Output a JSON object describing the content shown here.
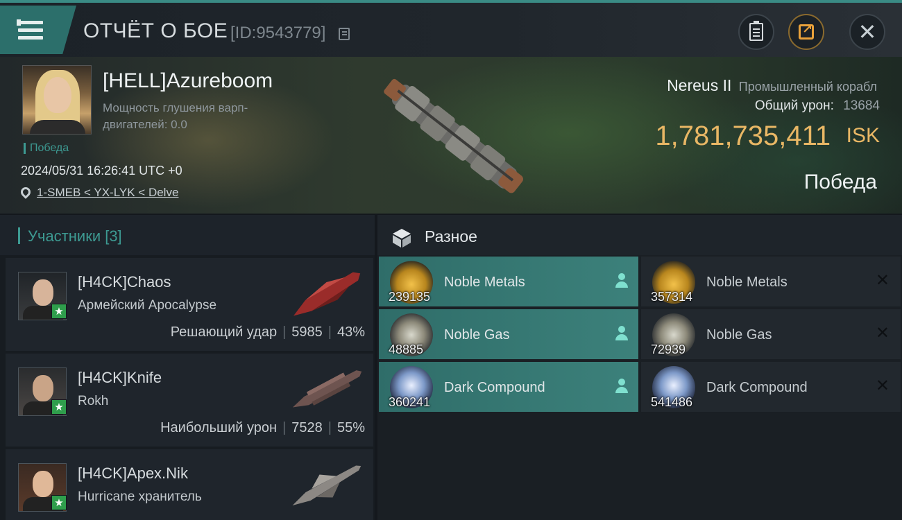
{
  "header": {
    "title": "ОТЧЁТ О БОЕ",
    "report_id": "[ID:9543779]"
  },
  "victim": {
    "name": "[HELL]Azureboom",
    "warp_label": "Мощность глушения варп-двигателей: 0.0",
    "status_tag": "Победа",
    "datetime": "2024/05/31 16:26:41 UTC +0",
    "location": "1-SMEB < YX-LYK < Delve",
    "ship_name": "Nereus II",
    "ship_class": "Промышленный корабл",
    "total_damage_label": "Общий урон:",
    "total_damage": "13684",
    "isk_value": "1,781,735,411",
    "isk_currency": "ISK",
    "outcome": "Победа"
  },
  "participants": {
    "header": "Участники [3]",
    "items": [
      {
        "name": "[H4CK]Chaos",
        "ship": "Армейский Apocalypse",
        "role": "Решающий удар",
        "damage": "5985",
        "percent": "43%"
      },
      {
        "name": "[H4CK]Knife",
        "ship": "Rokh",
        "role": "Наибольший урон",
        "damage": "7528",
        "percent": "55%"
      },
      {
        "name": "[H4CK]Apex.Nik",
        "ship": "Hurricane хранитель"
      }
    ]
  },
  "misc": {
    "title": "Разное",
    "dropped": [
      {
        "name": "Noble Metals",
        "qty": "239135",
        "icon": "noble-metals-icon"
      },
      {
        "name": "Noble Gas",
        "qty": "48885",
        "icon": "noble-gas-icon"
      },
      {
        "name": "Dark Compound",
        "qty": "360241",
        "icon": "dark-compound-icon"
      }
    ],
    "destroyed": [
      {
        "name": "Noble Metals",
        "qty": "357314",
        "icon": "noble-metals-icon"
      },
      {
        "name": "Noble Gas",
        "qty": "72939",
        "icon": "noble-gas-icon"
      },
      {
        "name": "Dark Compound",
        "qty": "541486",
        "icon": "dark-compound-icon"
      }
    ]
  },
  "colors": {
    "accent_teal": "#3d9a92",
    "isk_gold": "#e9b765",
    "highlight_row": "#3c817b",
    "badge_green": "#2f9e4c"
  }
}
